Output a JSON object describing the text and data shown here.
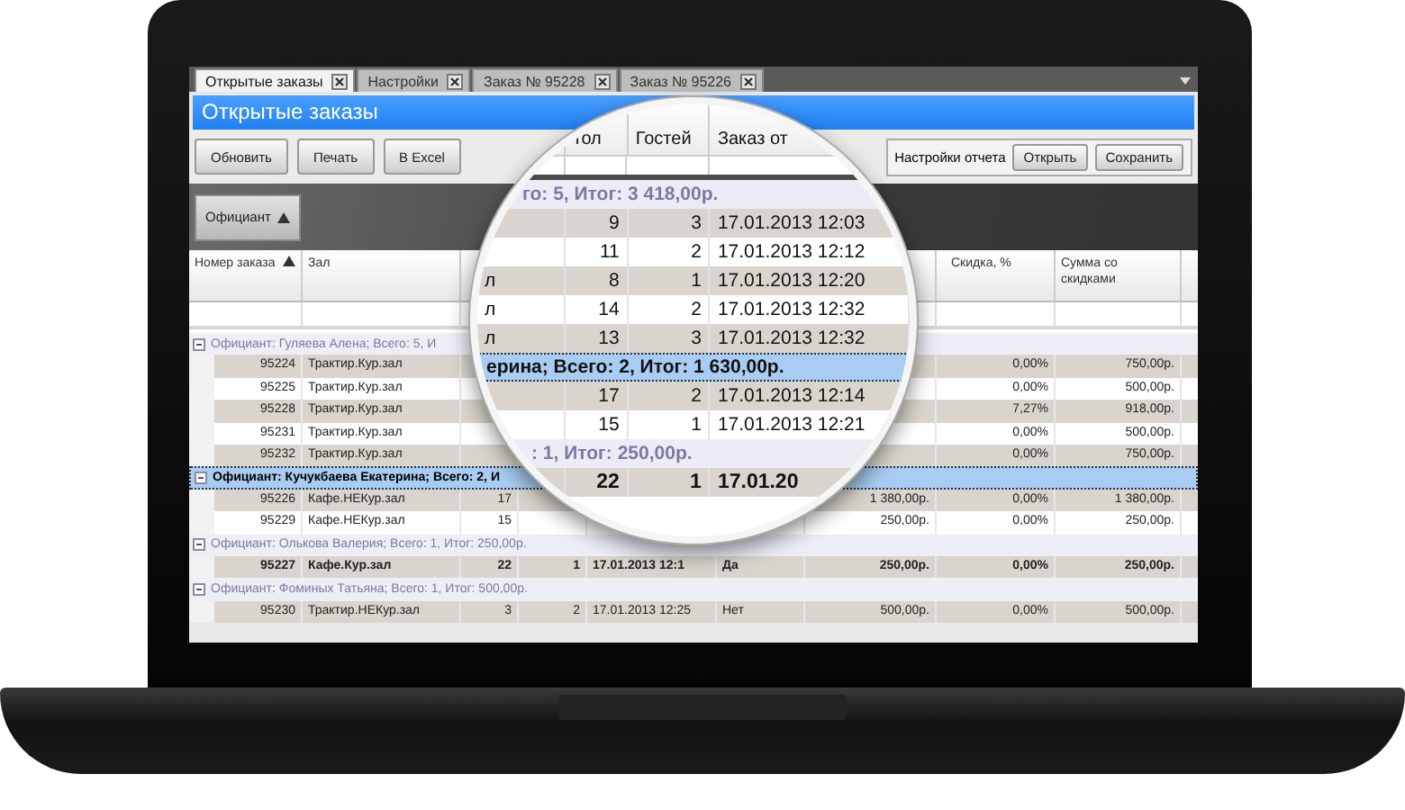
{
  "tabs": [
    {
      "label": "Открытые заказы",
      "selected": true
    },
    {
      "label": "Настройки",
      "selected": false
    },
    {
      "label": "Заказ № 95228",
      "selected": false
    },
    {
      "label": "Заказ № 95226",
      "selected": false
    }
  ],
  "title": "Открытые заказы",
  "toolbar": {
    "buttons": [
      "Обновить",
      "Печать",
      "В Excel"
    ],
    "report_settings": {
      "label": "Настройки отчета",
      "buttons": [
        "Открыть",
        "Сохранить"
      ]
    }
  },
  "grouping": {
    "chips": [
      {
        "label": "Официант",
        "sorted": true
      }
    ]
  },
  "table": {
    "columns": [
      {
        "label": "Номер заказа",
        "sorted": true
      },
      {
        "label": "Зал",
        "sorted": false
      },
      {
        "label": "Скидка, %",
        "sorted": false
      },
      {
        "label": "Сумма со скидками",
        "sorted": false
      }
    ],
    "rows": [
      {
        "kind": "group",
        "text": "Официант: Гуляева Алена; Всего: 5, И",
        "expanded": true,
        "focused": false
      },
      {
        "kind": "order",
        "selected": false,
        "cells": {
          "number": "95224",
          "hall": "Трактир.Кур.зал",
          "discount": "0,00%",
          "total": "750,00р."
        }
      },
      {
        "kind": "order",
        "selected": false,
        "cells": {
          "number": "95225",
          "hall": "Трактир.Кур.зал",
          "discount": "0,00%",
          "total": "500,00р."
        }
      },
      {
        "kind": "order",
        "selected": false,
        "cells": {
          "number": "95228",
          "hall": "Трактир.Кур.зал",
          "discount": "7,27%",
          "total": "918,00р."
        }
      },
      {
        "kind": "order",
        "selected": false,
        "cells": {
          "number": "95231",
          "hall": "Трактир.Кур.зал",
          "discount": "0,00%",
          "total": "500,00р."
        }
      },
      {
        "kind": "order",
        "selected": false,
        "cells": {
          "number": "95232",
          "hall": "Трактир.Кур.зал",
          "discount": "0,00%",
          "total": "750,00р."
        }
      },
      {
        "kind": "group",
        "text": "Официант: Кучукбаева Екатерина; Всего: 2, И",
        "expanded": true,
        "focused": true
      },
      {
        "kind": "order",
        "selected": false,
        "cells": {
          "number": "95226",
          "hall": "Кафе.НЕКур.зал",
          "table": "17",
          "column_7": "1 380,00р.",
          "discount": "0,00%",
          "total": "1 380,00р."
        }
      },
      {
        "kind": "order",
        "selected": false,
        "cells": {
          "number": "95229",
          "hall": "Кафе.НЕКур.зал",
          "table": "15",
          "column_7": "250,00р.",
          "discount": "0,00%",
          "total": "250,00р."
        }
      },
      {
        "kind": "group",
        "text": "Официант: Олькова Валерия; Всего: 1, Итог: 250,00р.",
        "expanded": true,
        "focused": false
      },
      {
        "kind": "order",
        "selected": true,
        "cells": {
          "number": "95227",
          "hall": "Кафе.Кур.зал",
          "table": "22",
          "guests": "1",
          "opened": "17.01.2013 12:1",
          "column_6": "Да",
          "column_7": "250,00р.",
          "discount": "0,00%",
          "total": "250,00р."
        }
      },
      {
        "kind": "group",
        "text": "Официант: Фоминых Татьяна; Всего: 1, Итог: 500,00р.",
        "expanded": true,
        "focused": false
      },
      {
        "kind": "order",
        "selected": false,
        "cells": {
          "number": "95230",
          "hall": "Трактир.НЕКур.зал",
          "table": "3",
          "guests": "2",
          "opened": "17.01.2013 12:25",
          "column_6": "Нет",
          "column_7": "500,00р.",
          "discount": "0,00%",
          "total": "500,00р."
        }
      }
    ]
  },
  "magnifier": {
    "columns": [
      {
        "label": "тол"
      },
      {
        "label": "Гостей"
      },
      {
        "label": "Заказ от"
      }
    ],
    "rows": [
      {
        "kind": "group",
        "text": "го: 5, Итог: 3 418,00р.",
        "focused": false
      },
      {
        "kind": "order",
        "selected": false,
        "cells": {
          "table": "9",
          "guests": "3",
          "opened": "17.01.2013 12:03"
        }
      },
      {
        "kind": "order",
        "selected": false,
        "cells": {
          "table": "11",
          "guests": "2",
          "opened": "17.01.2013 12:12"
        }
      },
      {
        "kind": "order",
        "selected": false,
        "cells": {
          "hall": "л",
          "table": "8",
          "guests": "1",
          "opened": "17.01.2013 12:20"
        }
      },
      {
        "kind": "order",
        "selected": false,
        "cells": {
          "hall": "л",
          "table": "14",
          "guests": "2",
          "opened": "17.01.2013 12:32"
        }
      },
      {
        "kind": "order",
        "selected": false,
        "cells": {
          "hall": "л",
          "table": "13",
          "guests": "3",
          "opened": "17.01.2013 12:32"
        }
      },
      {
        "kind": "group",
        "text": "ерина; Всего: 2, Итог: 1 630,00р.",
        "focused": true
      },
      {
        "kind": "order",
        "selected": false,
        "cells": {
          "table": "17",
          "guests": "2",
          "opened": "17.01.2013 12:14"
        }
      },
      {
        "kind": "order",
        "selected": false,
        "cells": {
          "table": "15",
          "guests": "1",
          "opened": "17.01.2013 12:21"
        }
      },
      {
        "kind": "group",
        "text": ": 1, Итог: 250,00р.",
        "focused": false
      },
      {
        "kind": "order",
        "selected": true,
        "cells": {
          "table": "22",
          "guests": "1",
          "opened": "17.01.20"
        }
      }
    ]
  }
}
